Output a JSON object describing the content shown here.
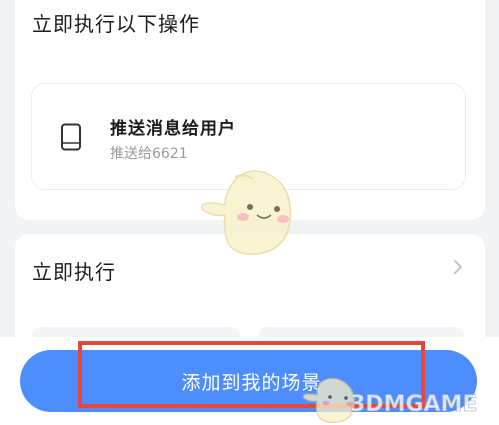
{
  "colors": {
    "background": "#f2f3f5",
    "card": "#ffffff",
    "primary_button": "#4d8dff",
    "highlight": "#e5473a",
    "text_primary": "#1c1c1c",
    "text_secondary": "#9a9a9a"
  },
  "actions_section": {
    "title": "立即执行以下操作",
    "item": {
      "icon": "phone-icon",
      "title": "推送消息给用户",
      "subtitle": "推送给6621"
    }
  },
  "execute_section": {
    "title": "立即执行",
    "icon": "chevron-right-icon"
  },
  "add_button": {
    "label": "添加到我的场景"
  },
  "watermark": {
    "text": "3DMGAME"
  }
}
